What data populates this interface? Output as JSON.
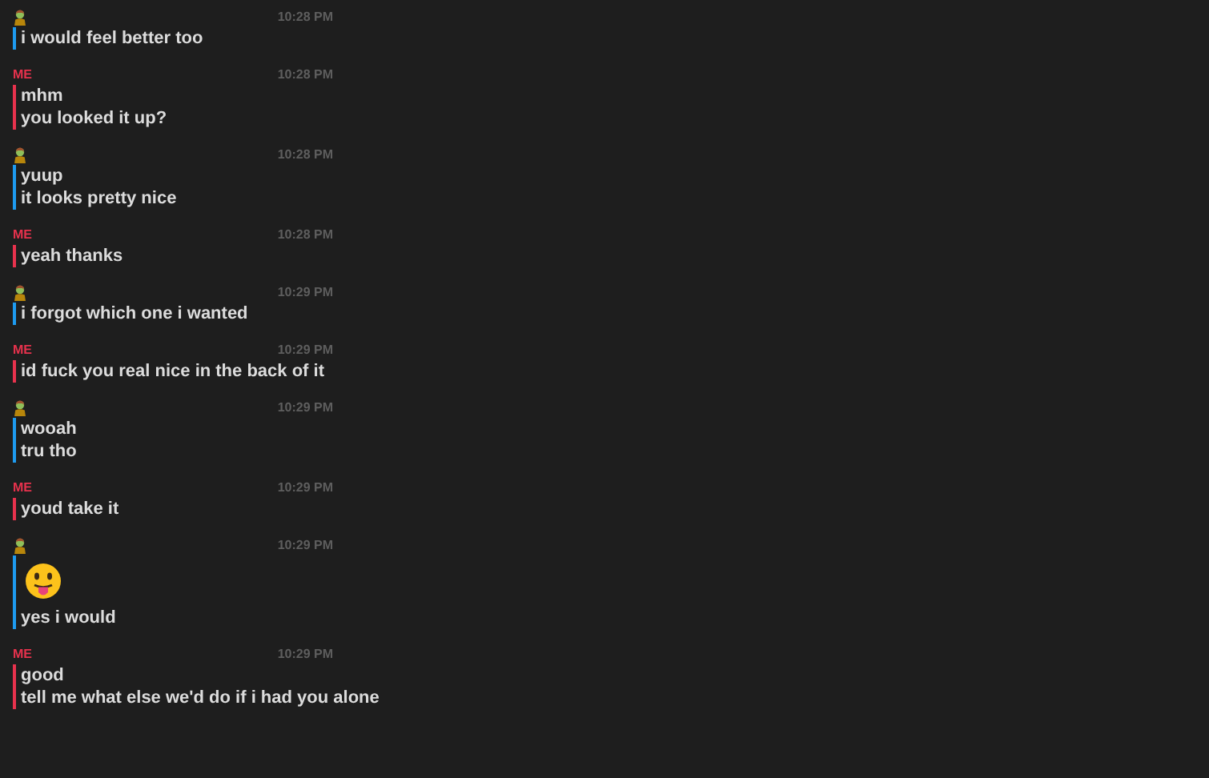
{
  "messages": [
    {
      "sender": {
        "kind": "them"
      },
      "time": "10:28 PM",
      "lines": [
        {
          "kind": "text",
          "text": "i would feel better too"
        }
      ]
    },
    {
      "sender": {
        "kind": "me",
        "name": "ME"
      },
      "time": "10:28 PM",
      "lines": [
        {
          "kind": "text",
          "text": "mhm"
        },
        {
          "kind": "text",
          "text": "you looked it up?"
        }
      ]
    },
    {
      "sender": {
        "kind": "them"
      },
      "time": "10:28 PM",
      "lines": [
        {
          "kind": "text",
          "text": "yuup"
        },
        {
          "kind": "text",
          "text": "it looks pretty nice"
        }
      ]
    },
    {
      "sender": {
        "kind": "me",
        "name": "ME"
      },
      "time": "10:28 PM",
      "lines": [
        {
          "kind": "text",
          "text": "yeah thanks"
        }
      ]
    },
    {
      "sender": {
        "kind": "them"
      },
      "time": "10:29 PM",
      "lines": [
        {
          "kind": "text",
          "text": "i forgot which one i wanted"
        }
      ]
    },
    {
      "sender": {
        "kind": "me",
        "name": "ME"
      },
      "time": "10:29 PM",
      "lines": [
        {
          "kind": "text",
          "text": "id fuck you real nice in the back of it"
        }
      ]
    },
    {
      "sender": {
        "kind": "them"
      },
      "time": "10:29 PM",
      "lines": [
        {
          "kind": "text",
          "text": "wooah"
        },
        {
          "kind": "text",
          "text": "tru tho"
        }
      ]
    },
    {
      "sender": {
        "kind": "me",
        "name": "ME"
      },
      "time": "10:29 PM",
      "lines": [
        {
          "kind": "text",
          "text": "youd take it"
        }
      ]
    },
    {
      "sender": {
        "kind": "them"
      },
      "time": "10:29 PM",
      "lines": [
        {
          "kind": "emoji"
        },
        {
          "kind": "text",
          "text": "yes i would"
        }
      ]
    },
    {
      "sender": {
        "kind": "me",
        "name": "ME"
      },
      "time": "10:29 PM",
      "lines": [
        {
          "kind": "text",
          "text": "good"
        },
        {
          "kind": "text",
          "text": "tell me what else we'd do if i had you alone"
        }
      ]
    }
  ]
}
